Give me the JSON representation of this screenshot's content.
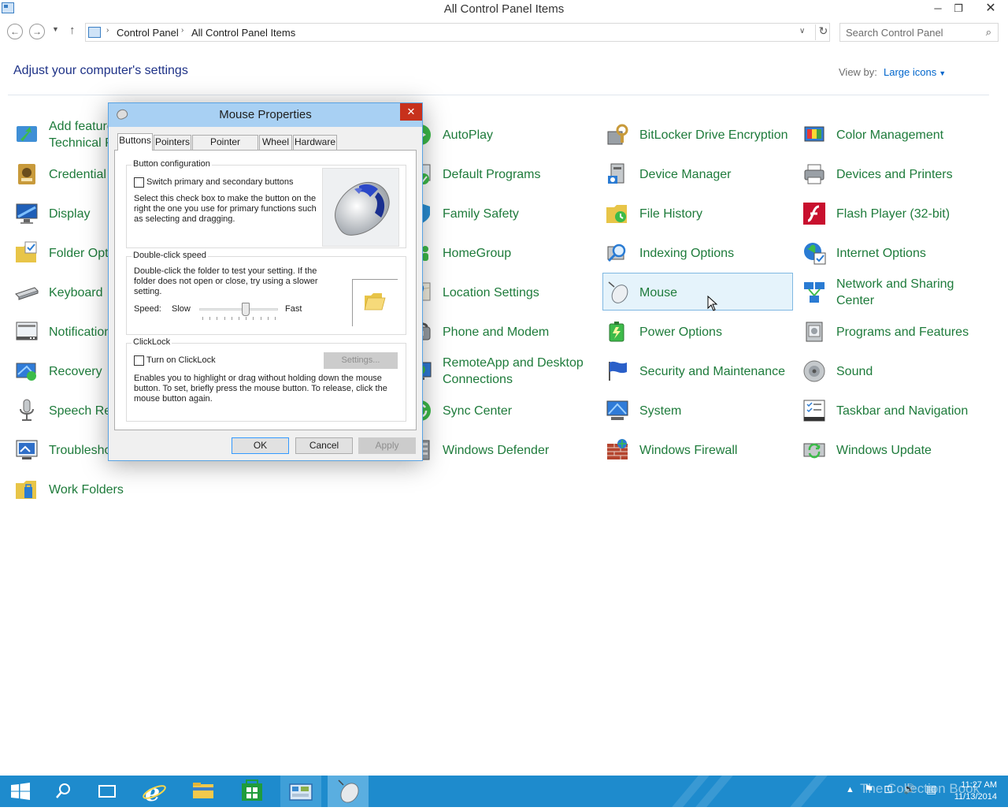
{
  "window": {
    "title": "All Control Panel Items",
    "minimize_glyph": "─",
    "maximize_glyph": "❐",
    "close_glyph": "✕"
  },
  "nav": {
    "back_glyph": "←",
    "forward_glyph": "→",
    "recent_glyph": "▼",
    "up_glyph": "↑",
    "breadcrumb": [
      "Control Panel",
      "All Control Panel Items"
    ],
    "separator_glyph": "›",
    "dropdown_glyph": "∨",
    "refresh_glyph": "↻",
    "search_placeholder": "Search Control Panel",
    "search_glyph": "⌕"
  },
  "header": {
    "heading": "Adjust your computer's settings",
    "view_by_label": "View by:",
    "view_by_value": "Large icons",
    "view_by_caret": "▼"
  },
  "items": {
    "c0": [
      "Add features to Windows Technical Preview",
      "Credential Manager",
      "Display",
      "Folder Options",
      "Keyboard",
      "Notification Area Icons",
      "Recovery",
      "Speech Recognition",
      "Troubleshooting",
      "Work Folders"
    ],
    "c2": [
      "AutoPlay",
      "Default Programs",
      "Family Safety",
      "HomeGroup",
      "Location Settings",
      "Phone and Modem",
      "RemoteApp and Desktop Connections",
      "Sync Center",
      "Windows Defender"
    ],
    "c3": [
      "BitLocker Drive Encryption",
      "Device Manager",
      "File History",
      "Indexing Options",
      "Mouse",
      "Power Options",
      "Security and Maintenance",
      "System",
      "Windows Firewall"
    ],
    "c4": [
      "Color Management",
      "Devices and Printers",
      "Flash Player (32-bit)",
      "Internet Options",
      "Network and Sharing Center",
      "Programs and Features",
      "Sound",
      "Taskbar and Navigation",
      "Windows Update"
    ]
  },
  "icons": {
    "c0": [
      "add-features-icon",
      "credential-manager-icon",
      "display-icon",
      "folder-options-icon",
      "keyboard-icon",
      "notification-area-icon",
      "recovery-icon",
      "speech-recognition-icon",
      "troubleshooting-icon",
      "work-folders-icon"
    ],
    "c2": [
      "autoplay-icon",
      "default-programs-icon",
      "family-safety-icon",
      "homegroup-icon",
      "location-settings-icon",
      "phone-modem-icon",
      "remoteapp-icon",
      "sync-center-icon",
      "windows-defender-icon"
    ],
    "c3": [
      "bitlocker-icon",
      "device-manager-icon",
      "file-history-icon",
      "indexing-options-icon",
      "mouse-icon",
      "power-options-icon",
      "security-maintenance-icon",
      "system-icon",
      "windows-firewall-icon"
    ],
    "c4": [
      "color-management-icon",
      "devices-printers-icon",
      "flash-player-icon",
      "internet-options-icon",
      "network-sharing-icon",
      "programs-features-icon",
      "sound-icon",
      "taskbar-navigation-icon",
      "windows-update-icon"
    ]
  },
  "selected_item": "Mouse",
  "dialog": {
    "title": "Mouse Properties",
    "close_glyph": "✕",
    "tabs": [
      "Buttons",
      "Pointers",
      "Pointer Options",
      "Wheel",
      "Hardware"
    ],
    "active_tab": "Buttons",
    "button_config": {
      "label": "Button configuration",
      "checkbox_label": "Switch primary and secondary buttons",
      "checked": false,
      "description": [
        "Select this check box to make the button on the",
        "right the one you use for primary functions such",
        "as selecting and dragging."
      ]
    },
    "double_click": {
      "label": "Double-click speed",
      "description": [
        "Double-click the folder to test your setting. If the",
        "folder does not open or close, try using a slower",
        "setting."
      ],
      "speed_label": "Speed:",
      "slow_label": "Slow",
      "fast_label": "Fast",
      "speed_fraction": 0.6
    },
    "clicklock": {
      "label": "ClickLock",
      "checkbox_label": "Turn on ClickLock",
      "checked": false,
      "settings_button": "Settings...",
      "description": [
        "Enables you to highlight or drag without holding down the mouse",
        "button. To set, briefly press the mouse button. To release, click the",
        "mouse button again."
      ]
    },
    "ok": "OK",
    "cancel": "Cancel",
    "apply": "Apply"
  },
  "taskbar": {
    "apps": [
      "start-button",
      "search-icon",
      "task-view-icon",
      "internet-explorer-icon",
      "file-explorer-icon",
      "store-icon",
      "control-panel-icon",
      "mouse-properties-icon"
    ],
    "tray_glyphs": [
      "▲",
      "⚑",
      "⊡",
      "🔊",
      "▤"
    ],
    "time": "11:27 AM",
    "date": "11/13/2014",
    "watermark": "The Collection Book"
  },
  "colors": {
    "link_green": "#1e7b3b",
    "heading_blue": "#1e3287",
    "taskbar": "#1e8bcd",
    "dialog_title": "#a8d0f3",
    "close_red": "#c7311c"
  }
}
